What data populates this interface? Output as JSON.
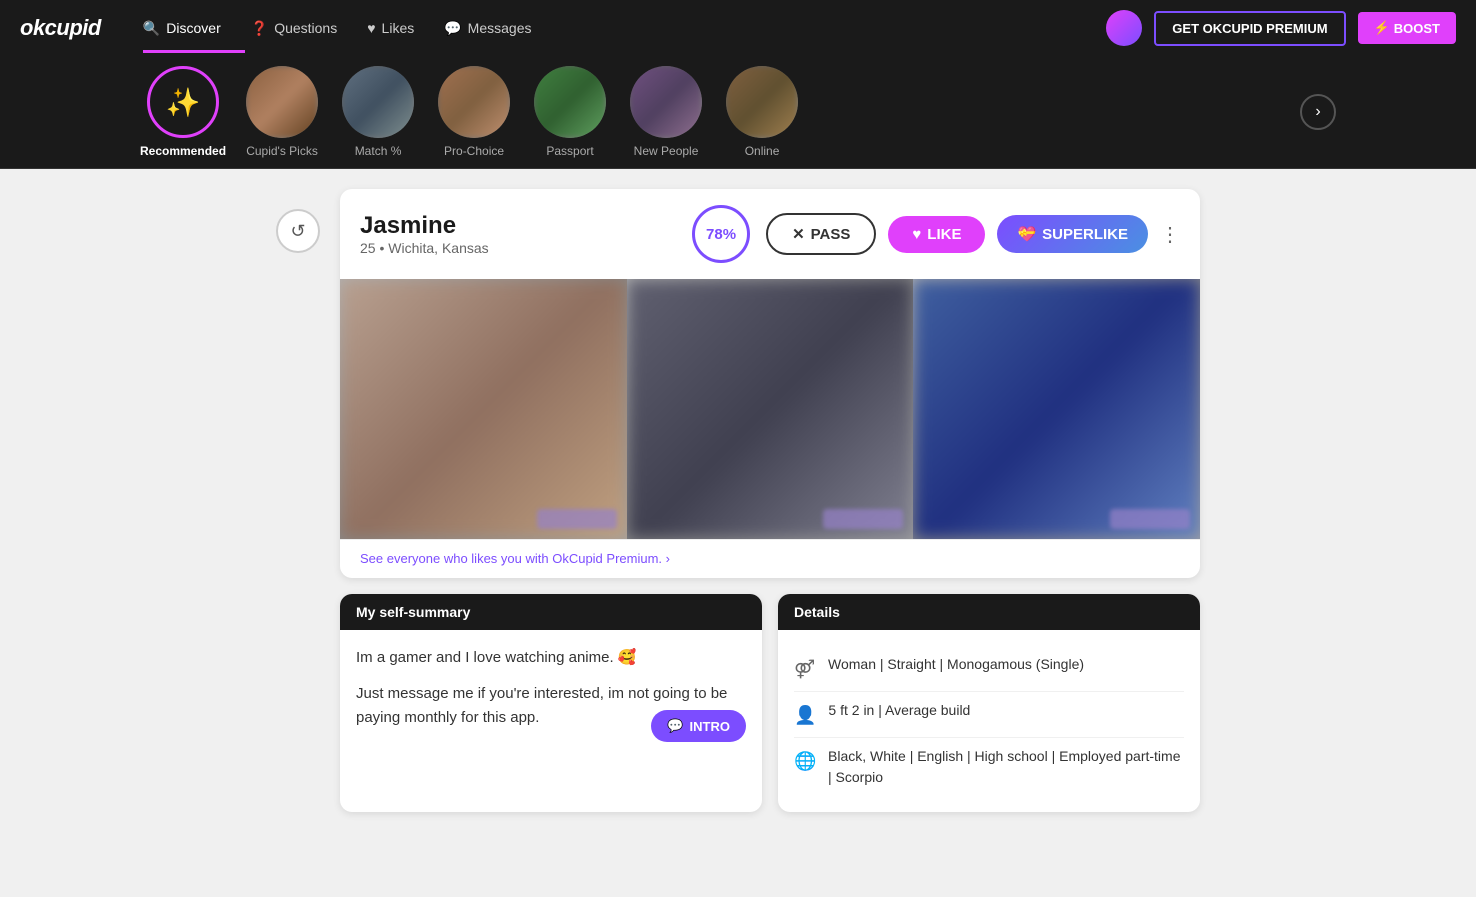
{
  "brand": {
    "name": "okcupid",
    "accent": "#e040fb"
  },
  "nav": {
    "items": [
      {
        "id": "discover",
        "label": "Discover",
        "active": true,
        "icon": "🔍"
      },
      {
        "id": "questions",
        "label": "Questions",
        "active": false,
        "icon": "❓"
      },
      {
        "id": "likes",
        "label": "Likes",
        "active": false,
        "icon": "♥"
      },
      {
        "id": "messages",
        "label": "Messages",
        "active": false,
        "icon": "💬"
      }
    ],
    "premium_btn": "GET OKCUPID PREMIUM",
    "boost_btn": "BOOST"
  },
  "categories": [
    {
      "id": "recommended",
      "label": "Recommended",
      "active": true
    },
    {
      "id": "cupids_picks",
      "label": "Cupid's Picks",
      "active": false
    },
    {
      "id": "match",
      "label": "Match %",
      "active": false
    },
    {
      "id": "pro_choice",
      "label": "Pro-Choice",
      "active": false
    },
    {
      "id": "passport",
      "label": "Passport",
      "active": false
    },
    {
      "id": "new_people",
      "label": "New People",
      "active": false
    },
    {
      "id": "online",
      "label": "Online",
      "active": false
    }
  ],
  "profile": {
    "name": "Jasmine",
    "age": "25",
    "location": "Wichita, Kansas",
    "match_percent": "78%",
    "buttons": {
      "pass": "PASS",
      "like": "LIKE",
      "superlike": "SUPERLIKE"
    },
    "premium_link": "See everyone who likes you with OkCupid Premium. ›",
    "self_summary": {
      "header": "My self-summary",
      "line1": "Im a gamer and I love watching anime. 🥰",
      "line2": "Just message me if you're interested, im not going to be paying monthly for this app.",
      "intro_btn": "INTRO"
    },
    "details": {
      "header": "Details",
      "rows": [
        {
          "icon": "♀",
          "text": "Woman | Straight | Monogamous (Single)"
        },
        {
          "icon": "👤",
          "text": "5 ft 2 in | Average build"
        },
        {
          "icon": "🌐",
          "text": "Black, White | English | High school | Employed part-time | Scorpio"
        }
      ]
    }
  }
}
